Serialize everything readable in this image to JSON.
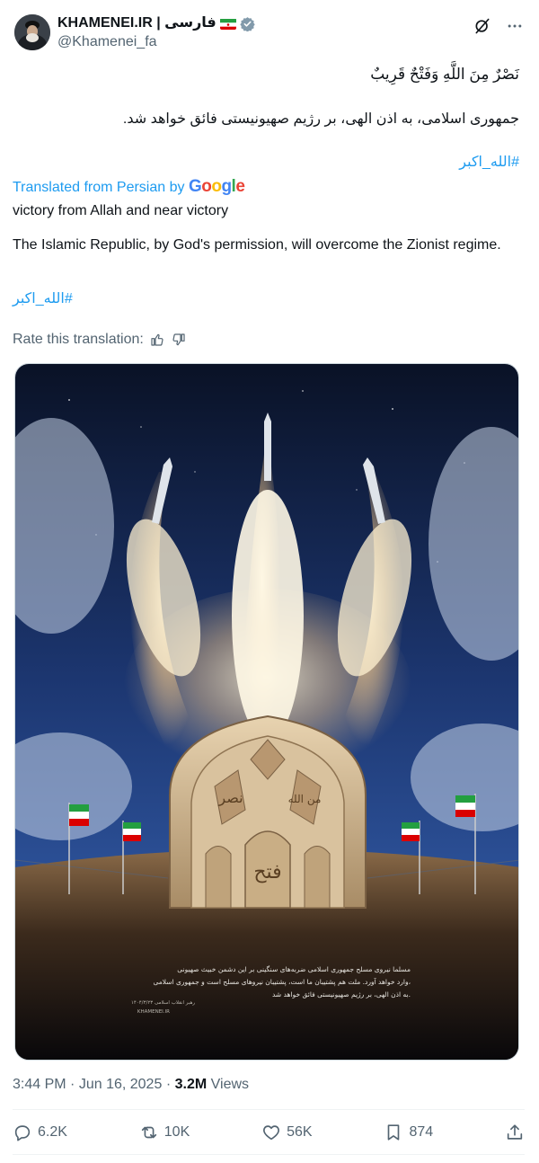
{
  "author": {
    "name": "KHAMENEI.IR | فارسی",
    "handle": "@Khamenei_fa"
  },
  "tweet": {
    "line1_fa": "نَصْرٌ مِنَ اللَّهِ وَفَتْحٌ قَرِيبٌ",
    "line2_fa": "جمهوری اسلامی، به اذن الهی، بر رژیم صهیونیستی فائق خواهد شد.",
    "hashtag_fa": "#الله_اکبر",
    "translated_label": "Translated from Persian by",
    "translator_brand": "Google",
    "translation_line1": "victory from Allah and near victory",
    "translation_line2": "The Islamic Republic, by God's permission, will overcome the Zionist regime.",
    "translation_hashtag": "#الله_اکبر",
    "rate_label": "Rate this translation:"
  },
  "media": {
    "poster_calligraphy_left": "نصر",
    "poster_calligraphy_center": "فتح",
    "poster_calligraphy_right": "من الله",
    "caption_line1": "مسلما نیروی مسلح جمهوری اسلامی ضربه‌های سنگینی بر این دشمن خبیث صهیونی",
    "caption_line2": "وارد خواهد آورد. ملت هم پشتیبان ما است، پشتیبان نیروهای مسلح است و جمهوری اسلامی،",
    "caption_line3": "به اذن الهی، بر رژیم صهیونیستی فائق خواهد شد.",
    "caption_source": "رهبر انقلاب اسلامی ۱۴۰۴/۳/۲۳",
    "caption_site": "KHAMENEI.IR"
  },
  "meta": {
    "time": "3:44 PM",
    "sep": "·",
    "date": "Jun 16, 2025",
    "views_count": "3.2M",
    "views_label": "Views"
  },
  "actions": {
    "replies": "6.2K",
    "reposts": "10K",
    "likes": "56K",
    "bookmarks": "874"
  },
  "colors": {
    "accent": "#1d9bf0",
    "muted": "#536471",
    "text": "#0f1419"
  }
}
